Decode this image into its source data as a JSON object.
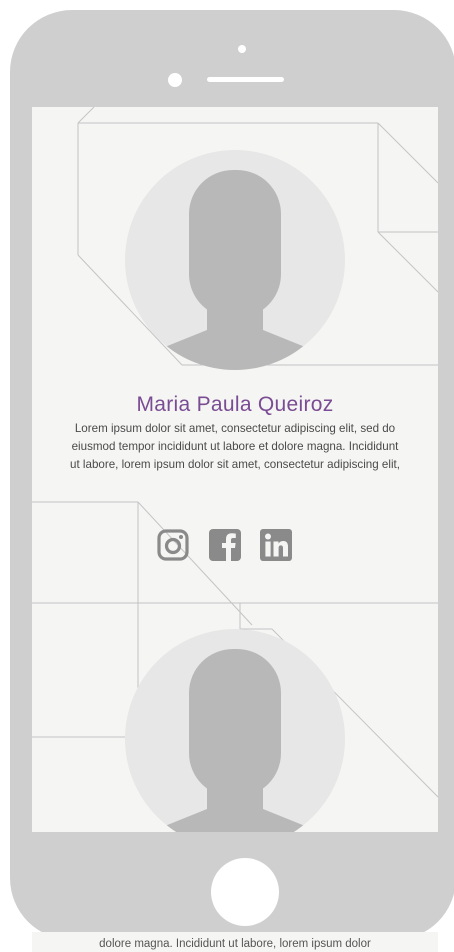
{
  "profile": {
    "name": "Maria Paula Queiroz",
    "bio": "Lorem ipsum dolor sit amet, consectetur adipiscing elit, sed do eiusmod tempor incididunt ut labore et dolore magna. Incididunt ut labore, lorem ipsum dolor sit amet, consectetur adipiscing elit,",
    "name_color": "#7a4c93"
  },
  "social": {
    "icons": [
      "instagram-icon",
      "facebook-icon",
      "linkedin-icon"
    ],
    "icon_color": "#8a8a8a"
  },
  "overflow": {
    "text": "dolore magna. Incididunt ut labore, lorem ipsum dolor"
  },
  "colors": {
    "device": "#cfcfcf",
    "screen": "#f5f5f3",
    "avatar_bg": "#e7e7e7",
    "silhouette": "#b8b8b8",
    "lines": "#c4c4c4"
  }
}
